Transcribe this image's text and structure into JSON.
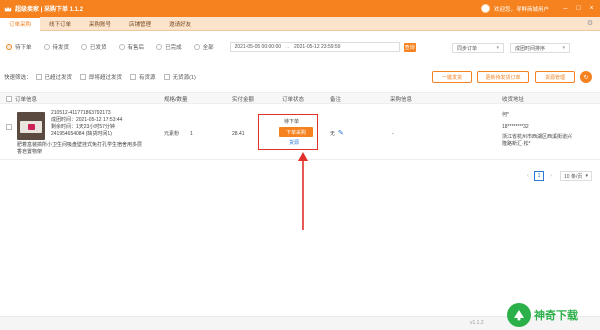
{
  "app": {
    "title": "超级卖家 | 采购下单 1.1.2",
    "user_text": "欢迎您，寻鲜商城用户"
  },
  "nav": {
    "tabs": [
      "订单采购",
      "线下订单",
      "采购账号",
      "店铺管理",
      "邀请好友"
    ]
  },
  "filters": {
    "status_options": [
      "待下单",
      "待发货",
      "已发货",
      "有售后",
      "已完成",
      "全部"
    ],
    "date_start": "2021-05-05 00:00:00",
    "date_sep": "→",
    "date_end": "2021-05-12 23:59:59",
    "search_label": "查询",
    "sync_select": "同步订单",
    "time_sort_select": "成团时间排序"
  },
  "quick": {
    "label": "快速筛选：",
    "options": [
      "已超过发货",
      "即将超过发货",
      "有货源",
      "无货源(1)"
    ],
    "buttons": [
      "一键发货",
      "更新待发货订单",
      "货源管理"
    ]
  },
  "table": {
    "headers": [
      "订单信息",
      "规格/数量",
      "实付金额",
      "订单状态",
      "备注",
      "采购信息",
      "收货地址"
    ],
    "row": {
      "order_no": "210512-411771863792173",
      "group_time": "成团时间：2021-05-12 17:53:44",
      "ship_deadline": "剩余时间：1天23小时57分钟",
      "order_code": "241954654084 (缺货时间1)",
      "title": "肥着盒装搞所小卫生间吸盘壁挂式免打孔学生宿舍用多层",
      "title2": "香皂置物架",
      "spec": "元素粉",
      "qty": "1",
      "amount": "28.41",
      "status": "待下单",
      "buy_button": "下单采购",
      "link": "货源",
      "remark": "无",
      "purchase_info": "-",
      "receiver": "何*",
      "phone": "18********32",
      "address": "浙江省杭州市西湖区西溪街道兴",
      "address2": "隆路新汇·松*"
    }
  },
  "pager": {
    "current": "1",
    "page_size": "10 条/页"
  },
  "footer": {
    "version": "v1.1.2"
  },
  "watermark": {
    "text": "神奇下载"
  }
}
